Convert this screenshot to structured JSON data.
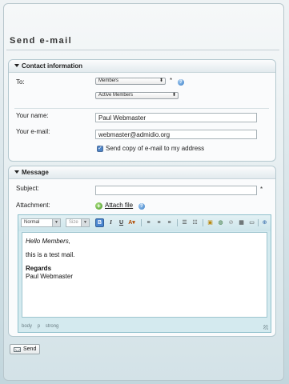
{
  "page": {
    "title": "Send e-mail"
  },
  "contact": {
    "heading": "Contact information",
    "to_label": "To:",
    "to_select_1": "Members",
    "to_select_2": "Active Members",
    "required_marker": "*",
    "name_label": "Your name:",
    "name_value": "Paul Webmaster",
    "email_label": "Your e-mail:",
    "email_value": "webmaster@admidio.org",
    "copy_label": "Send copy of e-mail to my address",
    "copy_checked": true
  },
  "message": {
    "heading": "Message",
    "subject_label": "Subject:",
    "subject_value": "",
    "attachment_label": "Attachment:",
    "attach_link": "Attach file"
  },
  "editor": {
    "format_select": "Normal",
    "size_select": "Size",
    "buttons": [
      "bold",
      "italic",
      "underline",
      "font-color",
      "align-left",
      "align-center",
      "align-right",
      "numbered-list",
      "bullet-list",
      "image",
      "link",
      "unlink",
      "table",
      "source"
    ],
    "body": {
      "greeting": "Hello Members,",
      "line": "this is a test mail.",
      "regards": "Regards",
      "signature": "Paul Webmaster"
    },
    "path": [
      "body",
      "p",
      "strong"
    ]
  },
  "actions": {
    "send_label": "Send"
  },
  "icons": {
    "help": "help-icon",
    "attach": "add-icon",
    "send": "envelope-icon"
  },
  "colors": {
    "accent": "#4b86cf",
    "editor_frame": "#d4eaef"
  }
}
